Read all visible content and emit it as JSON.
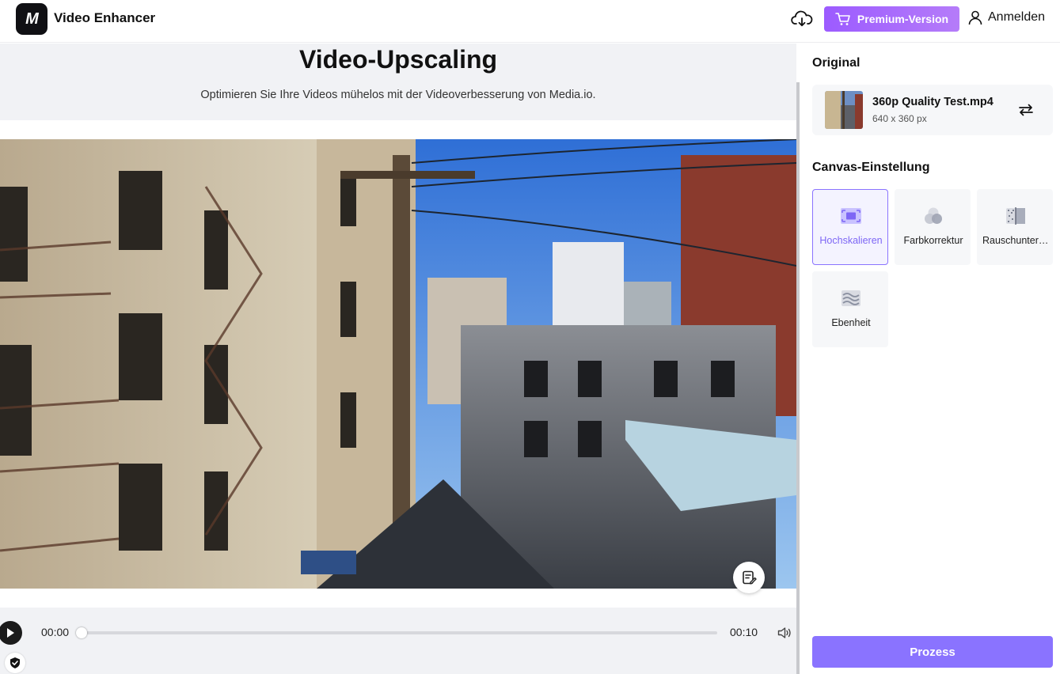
{
  "header": {
    "logo_text": "M",
    "app_title": "Video Enhancer",
    "premium_label": "Premium-Version",
    "login_label": "Anmelden"
  },
  "main": {
    "title": "Video-Upscaling",
    "subtitle": "Optimieren Sie Ihre Videos mühelos mit der Videoverbesserung von Media.io."
  },
  "player": {
    "current_time": "00:00",
    "duration": "00:10",
    "progress": 0
  },
  "panel": {
    "original_heading": "Original",
    "file": {
      "name": "360p Quality Test.mp4",
      "dimensions": "640 x 360 px"
    },
    "canvas_heading": "Canvas-Einstellung",
    "tools": [
      {
        "label": "Hochskalieren",
        "icon": "upscale-icon",
        "active": true
      },
      {
        "label": "Farbkorrektur",
        "icon": "color-correction-icon",
        "active": false
      },
      {
        "label": "Rauschunterdrückung",
        "icon": "denoise-icon",
        "active": false
      },
      {
        "label": "Ebenheit",
        "icon": "smoothness-icon",
        "active": false
      }
    ],
    "process_label": "Prozess"
  },
  "colors": {
    "accent": "#8a73ff",
    "premium_gradient_start": "#9c5bff",
    "premium_gradient_end": "#b57cf9",
    "background": "#f1f2f5"
  }
}
